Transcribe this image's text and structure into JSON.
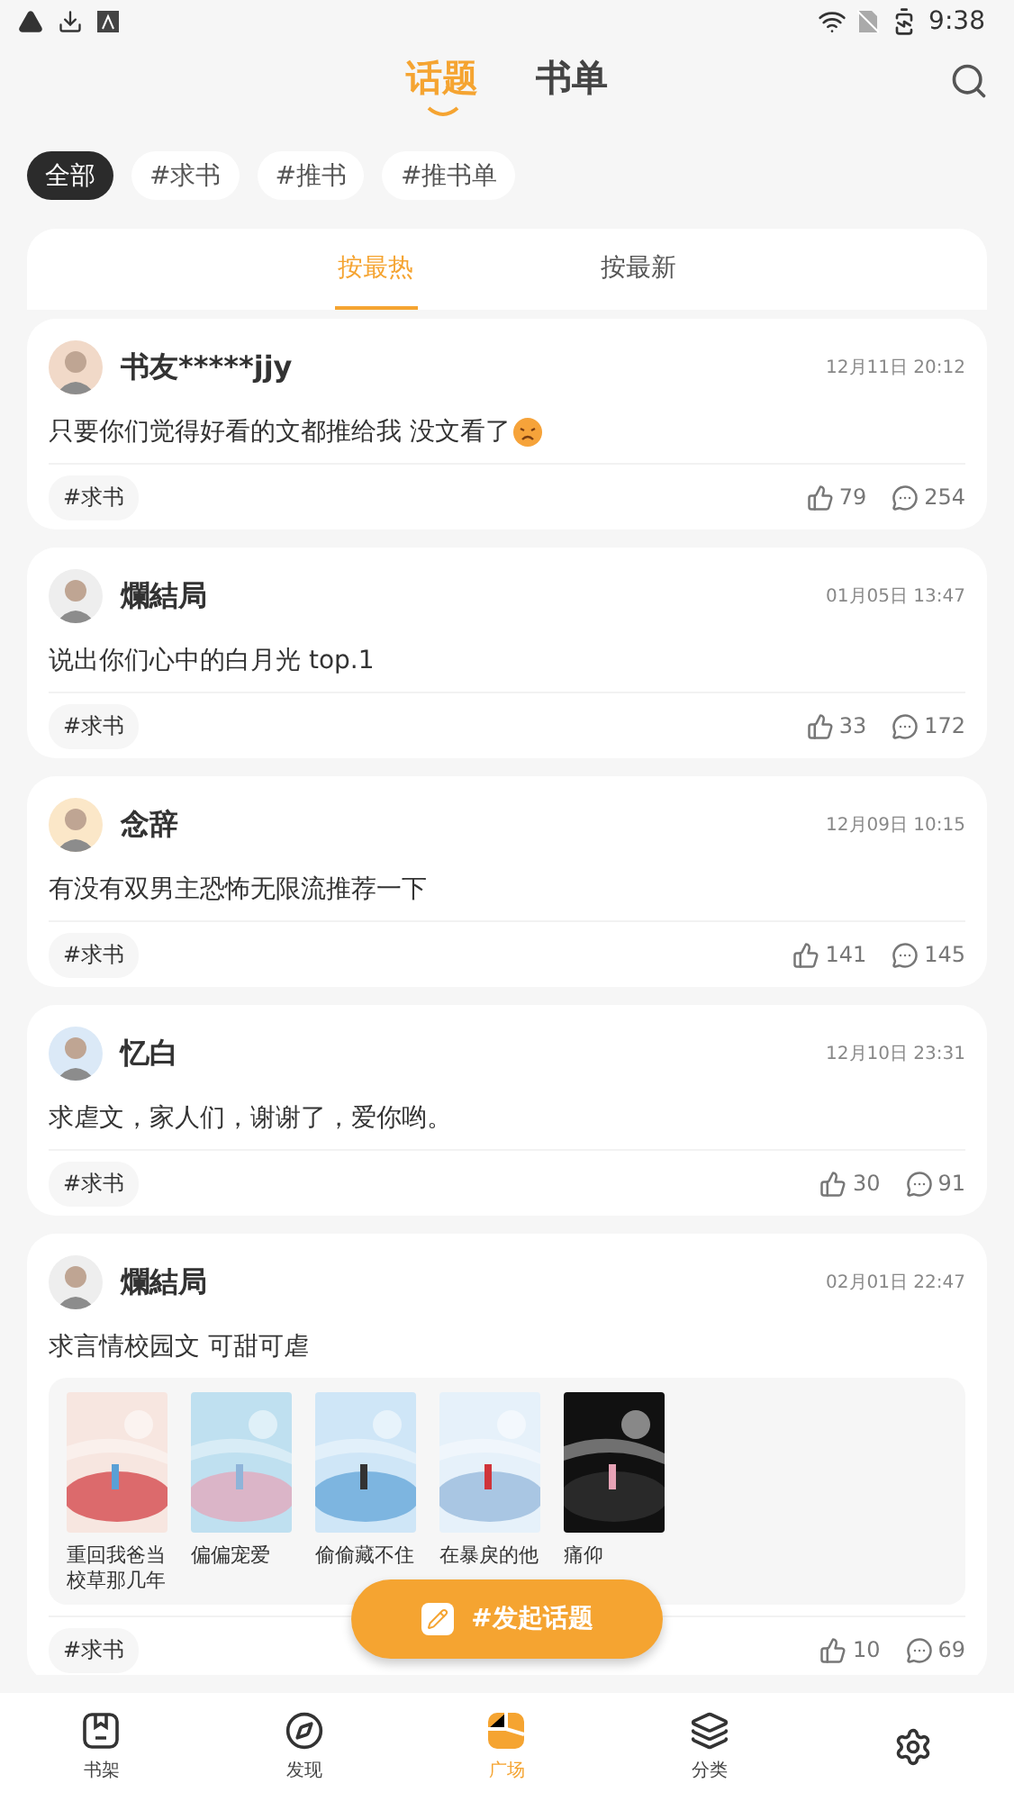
{
  "status_bar": {
    "time": "9:38"
  },
  "header_tabs": [
    {
      "label": "话题",
      "selected": true
    },
    {
      "label": "书单",
      "selected": false
    }
  ],
  "filter_chips": [
    {
      "label": "全部",
      "selected": true
    },
    {
      "label": "#求书",
      "selected": false
    },
    {
      "label": "#推书",
      "selected": false
    },
    {
      "label": "#推书单",
      "selected": false
    }
  ],
  "sort_tabs": [
    {
      "label": "按最热",
      "selected": true
    },
    {
      "label": "按最新",
      "selected": false
    }
  ],
  "posts": [
    {
      "user": "书友*****jjy",
      "time": "12月11日 20:12",
      "text": "只要你们觉得好看的文都推给我 没文看了",
      "emoji": true,
      "tag": "#求书",
      "likes": "79",
      "comments": "254"
    },
    {
      "user": "爛結局",
      "time": "01月05日 13:47",
      "text": "说出你们心中的白月光 top.1",
      "emoji": false,
      "tag": "#求书",
      "likes": "33",
      "comments": "172"
    },
    {
      "user": "念辞",
      "time": "12月09日 10:15",
      "text": "有没有双男主恐怖无限流推荐一下",
      "emoji": false,
      "tag": "#求书",
      "likes": "141",
      "comments": "145"
    },
    {
      "user": "忆白",
      "time": "12月10日 23:31",
      "text": "求虐文，家人们，谢谢了，爱你哟。",
      "emoji": false,
      "tag": "#求书",
      "likes": "30",
      "comments": "91"
    },
    {
      "user": "爛結局",
      "time": "02月01日 22:47",
      "text": "求言情校园文 可甜可虐",
      "emoji": false,
      "tag": "#求书",
      "likes": "10",
      "comments": "69",
      "books": [
        {
          "title": "重回我爸当校草那几年"
        },
        {
          "title": "偏偏宠爱"
        },
        {
          "title": "偷偷藏不住"
        },
        {
          "title": "在暴戾的他"
        },
        {
          "title": "痛仰"
        }
      ]
    }
  ],
  "fab": {
    "label": "#发起话题"
  },
  "bottom_nav": [
    {
      "kind": "shelf",
      "label": "书架",
      "selected": false
    },
    {
      "kind": "compass",
      "label": "发现",
      "selected": false
    },
    {
      "kind": "square",
      "label": "广场",
      "selected": true
    },
    {
      "kind": "layers",
      "label": "分类",
      "selected": false
    },
    {
      "kind": "gear",
      "selected": false
    }
  ]
}
